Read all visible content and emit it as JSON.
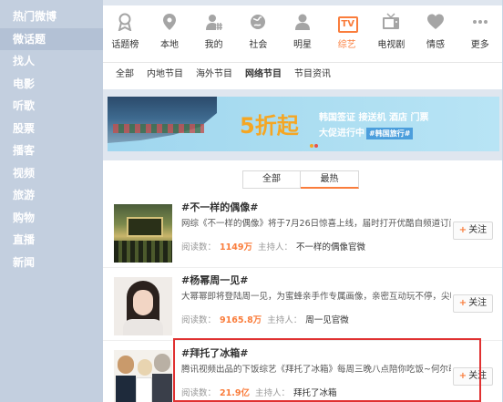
{
  "sidebar": {
    "items": [
      {
        "label": "热门微博"
      },
      {
        "label": "微话题",
        "active": true
      },
      {
        "label": "找人"
      },
      {
        "label": "电影"
      },
      {
        "label": "听歌"
      },
      {
        "label": "股票"
      },
      {
        "label": "播客"
      },
      {
        "label": "视频"
      },
      {
        "label": "旅游"
      },
      {
        "label": "购物"
      },
      {
        "label": "直播"
      },
      {
        "label": "新闻"
      }
    ]
  },
  "categories": [
    {
      "label": "话题榜",
      "icon": "badge-icon"
    },
    {
      "label": "本地",
      "icon": "location-pin-icon"
    },
    {
      "label": "我的",
      "icon": "user-hash-icon"
    },
    {
      "label": "社会",
      "icon": "globe-icon"
    },
    {
      "label": "明星",
      "icon": "person-icon"
    },
    {
      "label": "综艺",
      "icon": "tv-icon",
      "badge": "TV",
      "active": true
    },
    {
      "label": "电视剧",
      "icon": "television-icon"
    },
    {
      "label": "情感",
      "icon": "heart-icon"
    },
    {
      "label": "更多",
      "icon": "more-dots-icon"
    }
  ],
  "subtabs": [
    {
      "label": "全部"
    },
    {
      "label": "内地节目"
    },
    {
      "label": "海外节目"
    },
    {
      "label": "网络节目",
      "active": true
    },
    {
      "label": "节目资讯"
    }
  ],
  "banner": {
    "headline": "5折起",
    "line1": "韩国签证 接送机 酒店 门票",
    "line2": "大促进行中",
    "tag": "#韩国旅行#"
  },
  "filter_tabs": [
    {
      "label": "全部"
    },
    {
      "label": "最热",
      "active": true
    }
  ],
  "topics": [
    {
      "title": "#不一样的偶像#",
      "desc": "网综《不一样的偶像》将于7月26日惊喜上线，届时打开优酷自频道订阅",
      "read_label": "阅读数：",
      "reads": "1149万",
      "host_label": "主持人：",
      "host": "不一样的偶像官微",
      "follow": "关注"
    },
    {
      "title": "#杨幂周一见#",
      "desc": "大幂幂即将登陆周一见，为蜜蜂亲手作专属画像，亲密互动玩不停，尖叫",
      "read_label": "阅读数：",
      "reads": "9165.8万",
      "host_label": "主持人：",
      "host": "周一见官微",
      "follow": "关注"
    },
    {
      "title": "#拜托了冰箱#",
      "desc": "腾讯视频出品的下饭综艺《拜托了冰箱》每周三晚八点陪你吃饭~何尔萌和",
      "read_label": "阅读数：",
      "reads": "21.9亿",
      "host_label": "主持人：",
      "host": "拜托了冰箱",
      "follow": "关注"
    }
  ],
  "colors": {
    "accent": "#fa7d3c",
    "highlight_box": "#e03131",
    "sidebar_bg": "#c3cfdf"
  }
}
